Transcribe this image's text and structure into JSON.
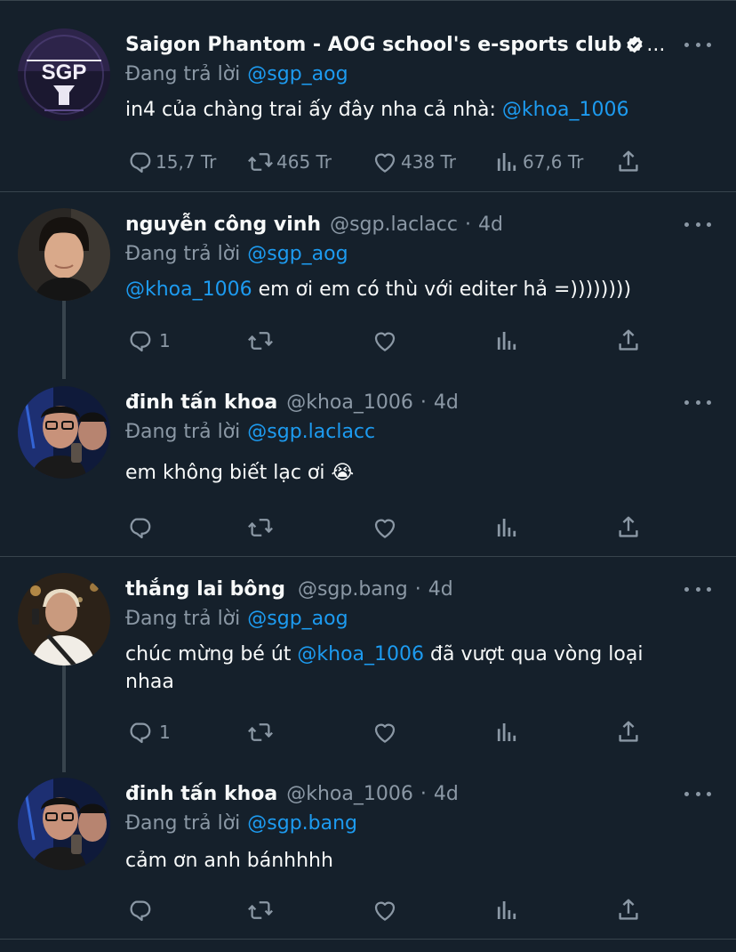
{
  "tweets": [
    {
      "name": "Saigon Phantom - AOG school's e-sports club",
      "handle": "",
      "time": "",
      "verified": true,
      "ellipsis": "...",
      "reply_prefix": "Đang trả lời",
      "reply_to": "@sgp_aog",
      "body_parts": [
        "in4 của chàng trai ấy đây nha cả nhà: ",
        "@khoa_1006",
        ""
      ],
      "counts": {
        "reply": "15,7 Tr",
        "retweet": "465 Tr",
        "like": "438 Tr",
        "views": "67,6 Tr"
      }
    },
    {
      "name": "nguyễn công vinh",
      "handle": "@sgp.laclacc",
      "time": "4d",
      "reply_prefix": "Đang trả lời",
      "reply_to": "@sgp_aog",
      "body_parts": [
        "",
        "@khoa_1006",
        " em ơi em có thù với editer hả =))))))))"
      ],
      "counts": {
        "reply": "1",
        "retweet": "",
        "like": "",
        "views": ""
      }
    },
    {
      "name": "đinh tấn khoa",
      "handle": "@khoa_1006",
      "time": "4d",
      "reply_prefix": "Đang trả lời",
      "reply_to": "@sgp.laclacc",
      "body_parts": [
        "em không biết lạc ơi 😭",
        "",
        ""
      ],
      "counts": {
        "reply": "",
        "retweet": "",
        "like": "",
        "views": ""
      }
    },
    {
      "name": "thắng lai bông",
      "handle": "@sgp.bang",
      "time": "4d",
      "reply_prefix": "Đang trả lời",
      "reply_to": "@sgp_aog",
      "body_parts": [
        "chúc mừng bé út ",
        "@khoa_1006",
        " đã vượt qua vòng loại nhaa"
      ],
      "counts": {
        "reply": "1",
        "retweet": "",
        "like": "",
        "views": ""
      }
    },
    {
      "name": "đinh tấn khoa",
      "handle": "@khoa_1006",
      "time": "4d",
      "reply_prefix": "Đang trả lời",
      "reply_to": "@sgp.bang",
      "body_parts": [
        "cảm ơn anh bánhhhh",
        "",
        ""
      ],
      "counts": {
        "reply": "",
        "retweet": "",
        "like": "",
        "views": ""
      }
    }
  ],
  "separator": "·",
  "icons": {
    "avatar": "avatar",
    "verified": "verified-badge-icon",
    "more": "more-icon",
    "reply": "reply-icon",
    "retweet": "retweet-icon",
    "like": "like-icon",
    "views": "views-icon",
    "share": "share-icon"
  },
  "colors": {
    "background": "#15202b",
    "text": "#f7f9f9",
    "muted": "#8b98a5",
    "link": "#1d9bf0",
    "divider": "#38444d"
  }
}
